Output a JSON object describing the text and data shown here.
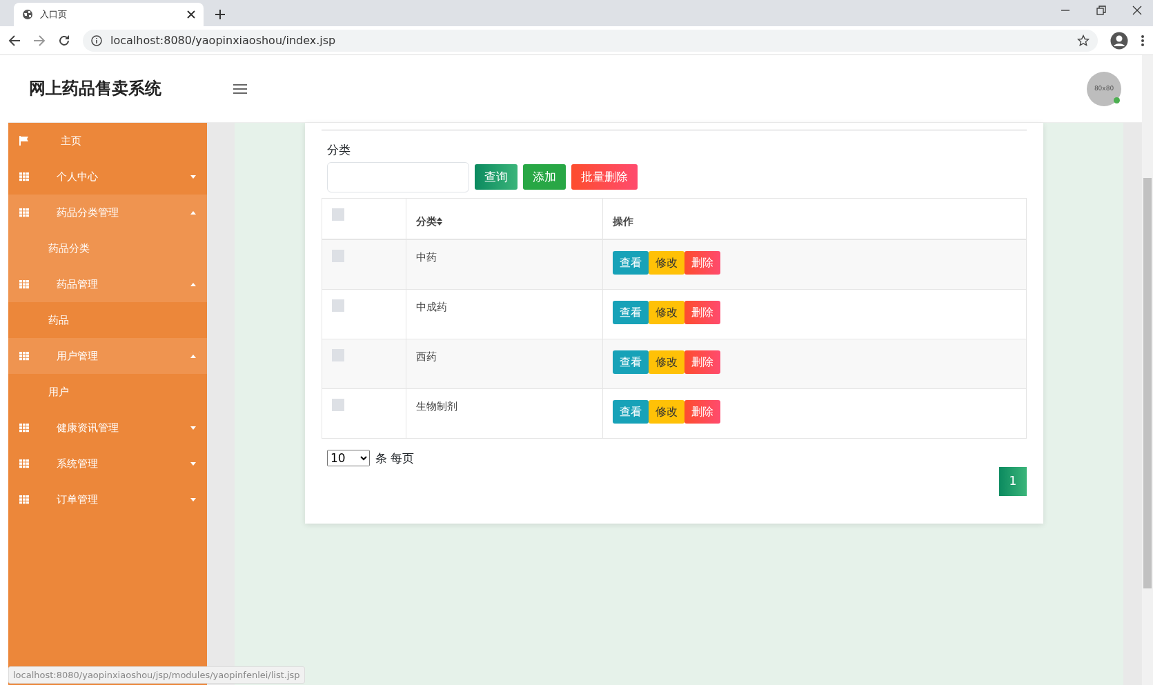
{
  "browser": {
    "tab_title": "入口页",
    "url": "localhost:8080/yaopinxiaoshou/index.jsp"
  },
  "header": {
    "title": "网上药品售卖系统",
    "avatar_text": "80x80",
    "online": true
  },
  "sidebar": {
    "items": [
      {
        "label": "主页",
        "kind": "home",
        "expanded": false
      },
      {
        "label": "个人中心",
        "kind": "group",
        "expanded": false
      },
      {
        "label": "药品分类管理",
        "kind": "group",
        "expanded": true,
        "children": [
          {
            "label": "药品分类",
            "selected": true
          }
        ]
      },
      {
        "label": "药品管理",
        "kind": "group",
        "expanded": true,
        "children": [
          {
            "label": "药品",
            "selected": false
          }
        ]
      },
      {
        "label": "用户管理",
        "kind": "group",
        "expanded": true,
        "children": [
          {
            "label": "用户",
            "selected": false
          }
        ]
      },
      {
        "label": "健康资讯管理",
        "kind": "group",
        "expanded": false
      },
      {
        "label": "系统管理",
        "kind": "group",
        "expanded": false
      },
      {
        "label": "订单管理",
        "kind": "group",
        "expanded": false
      }
    ]
  },
  "search": {
    "label": "分类",
    "buttons": [
      {
        "label": "查询",
        "kind": "query"
      },
      {
        "label": "添加",
        "kind": "add"
      },
      {
        "label": "批量删除",
        "kind": "delete"
      }
    ]
  },
  "table": {
    "select_all_checked": false,
    "columns": [
      "分类",
      "操作"
    ],
    "sortable": [
      true,
      false
    ],
    "rows": [
      {
        "checked": false,
        "category": "中药",
        "actions": [
          "查看",
          "修改",
          "删除"
        ]
      },
      {
        "checked": false,
        "category": "中成药",
        "actions": [
          "查看",
          "修改",
          "删除"
        ]
      },
      {
        "checked": false,
        "category": "西药",
        "actions": [
          "查看",
          "修改",
          "删除"
        ]
      },
      {
        "checked": false,
        "category": "生物制剂",
        "actions": [
          "查看",
          "修改",
          "删除"
        ]
      }
    ]
  },
  "pager": {
    "page_size": "10",
    "suffix": "条 每页",
    "pages": [
      {
        "label": "1",
        "selected": true
      }
    ]
  },
  "status_url": "localhost:8080/yaopinxiaoshou/jsp/modules/yaopinfenlei/list.jsp"
}
